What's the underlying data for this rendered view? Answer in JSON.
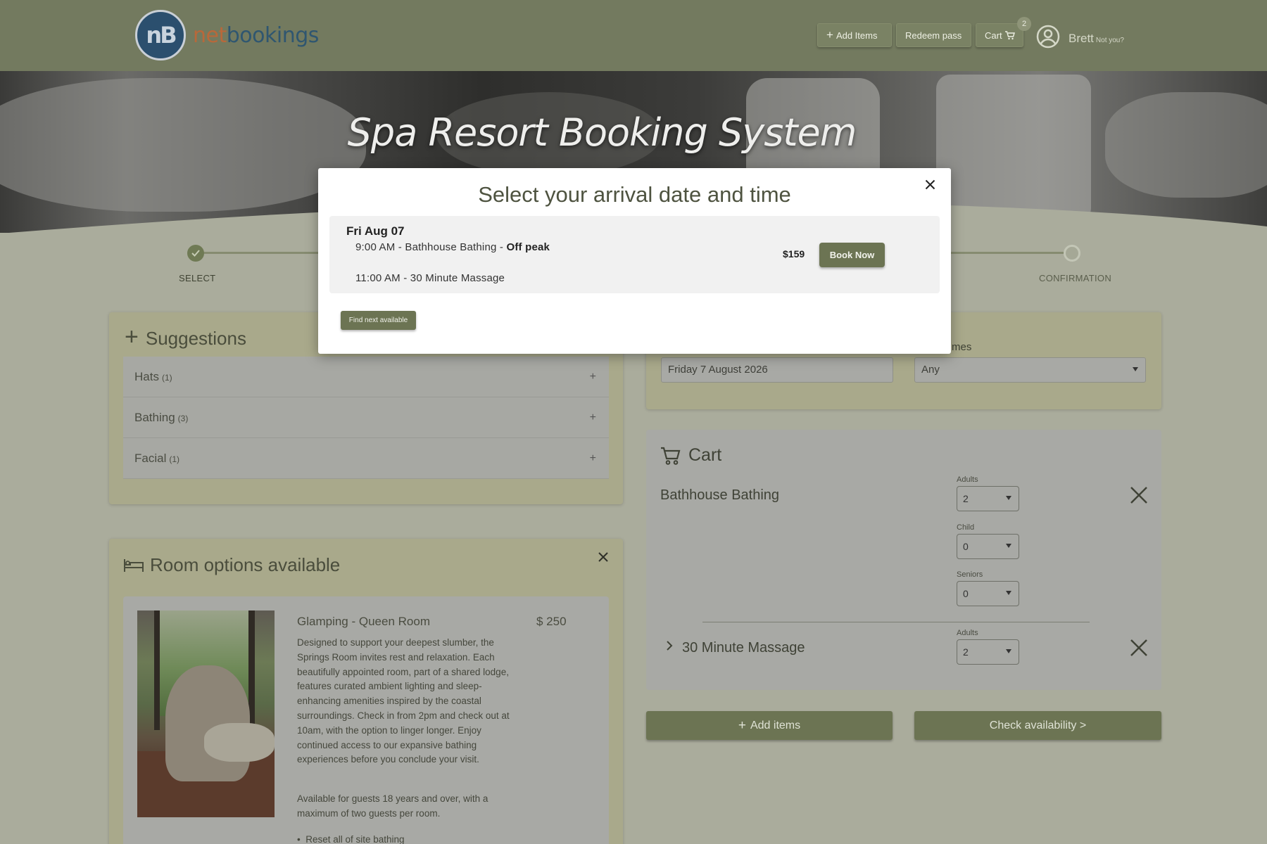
{
  "header": {
    "logo_mark": "nB",
    "logo_text_net": "net",
    "logo_text_bookings": "bookings",
    "add_items_label": "Add Items",
    "redeem_label": "Redeem pass",
    "cart_label": "Cart",
    "cart_count": "2",
    "user_name": "Brett",
    "not_you": "Not you?"
  },
  "hero": {
    "title": "Spa Resort Booking System"
  },
  "steps": {
    "first": "SELECT",
    "last": "CONFIRMATION"
  },
  "suggestions": {
    "title": "Suggestions",
    "items": [
      {
        "name": "Hats",
        "count": "(1)"
      },
      {
        "name": "Bathing",
        "count": "(3)"
      },
      {
        "name": "Facial",
        "count": "(1)"
      }
    ]
  },
  "rooms": {
    "title": "Room options available",
    "room": {
      "name": "Glamping - Queen Room",
      "price": "$ 250",
      "description": "Designed to support your deepest slumber, the Springs Room invites rest and relaxation. Each beautifully appointed room, part of a shared lodge, features curated ambient lighting and sleep-enhancing amenities inspired by the coastal surroundings. Check in from 2pm and check out at 10am, with the option to linger longer. Enjoy continued access to our expansive bathing experiences before you conclude your visit.",
      "availability": "Available for guests 18 years and over, with a maximum of two guests per room.",
      "bullet": "Reset all of site bathing"
    }
  },
  "booking": {
    "times_label": "mes",
    "date_value": "Friday 7 August 2026",
    "times_value": "Any"
  },
  "cart": {
    "title": "Cart",
    "items": [
      {
        "name": "Bathhouse Bathing",
        "adults_label": "Adults",
        "adults": "2",
        "child_label": "Child",
        "child": "0",
        "seniors_label": "Seniors",
        "seniors": "0"
      },
      {
        "name": "30 Minute Massage",
        "adults_label": "Adults",
        "adults": "2"
      }
    ],
    "add_items_label": "Add items",
    "check_label": "Check availability >"
  },
  "modal": {
    "title": "Select your arrival date and time",
    "date": "Fri Aug 07",
    "line1_prefix": "9:00 AM - Bathhouse Bathing - ",
    "line1_bold": "Off peak",
    "line2": "11:00 AM - 30 Minute Massage",
    "price": "$159",
    "book_label": "Book Now",
    "find_label": "Find next available"
  },
  "colors": {
    "accent": "#6c7453",
    "header_bg": "#737a5f",
    "panel_bg": "#a9a98b",
    "logo_orange": "#b8683a",
    "logo_blue": "#2f5670"
  }
}
